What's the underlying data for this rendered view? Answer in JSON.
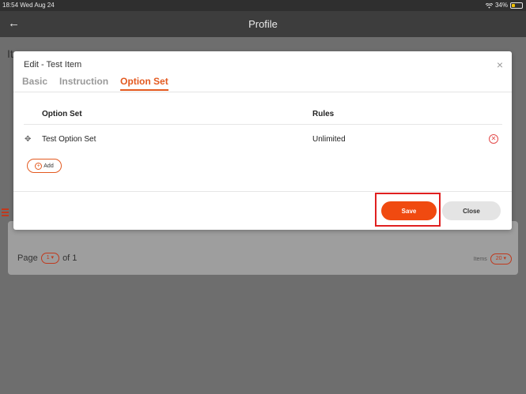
{
  "status_bar": {
    "time": "18:54",
    "date": "Wed Aug 24",
    "battery": "34%",
    "battery_level": 0.34,
    "wifi_icon": "wifi-icon"
  },
  "nav": {
    "title": "Profile",
    "back_icon": "arrow-left-icon"
  },
  "background": {
    "heading": "It",
    "pager": {
      "prefix": "Page",
      "page": "1 ▾",
      "suffix": "of 1"
    },
    "items": {
      "label": "Items",
      "value": "20 ▾"
    }
  },
  "modal": {
    "title": "Edit - Test Item",
    "close_icon": "×",
    "tabs": [
      {
        "label": "Basic",
        "active": false
      },
      {
        "label": "Instruction",
        "active": false
      },
      {
        "label": "Option Set",
        "active": true
      }
    ],
    "table": {
      "headers": [
        "Option Set",
        "Rules"
      ],
      "rows": [
        {
          "name": "Test Option Set",
          "rule": "Unlimited"
        }
      ]
    },
    "add_label": "Add",
    "save_label": "Save",
    "close_label": "Close"
  },
  "colors": {
    "accent": "#e35a20",
    "save": "#f04a10",
    "highlight": "#e02020",
    "remove": "#e34b4b"
  }
}
